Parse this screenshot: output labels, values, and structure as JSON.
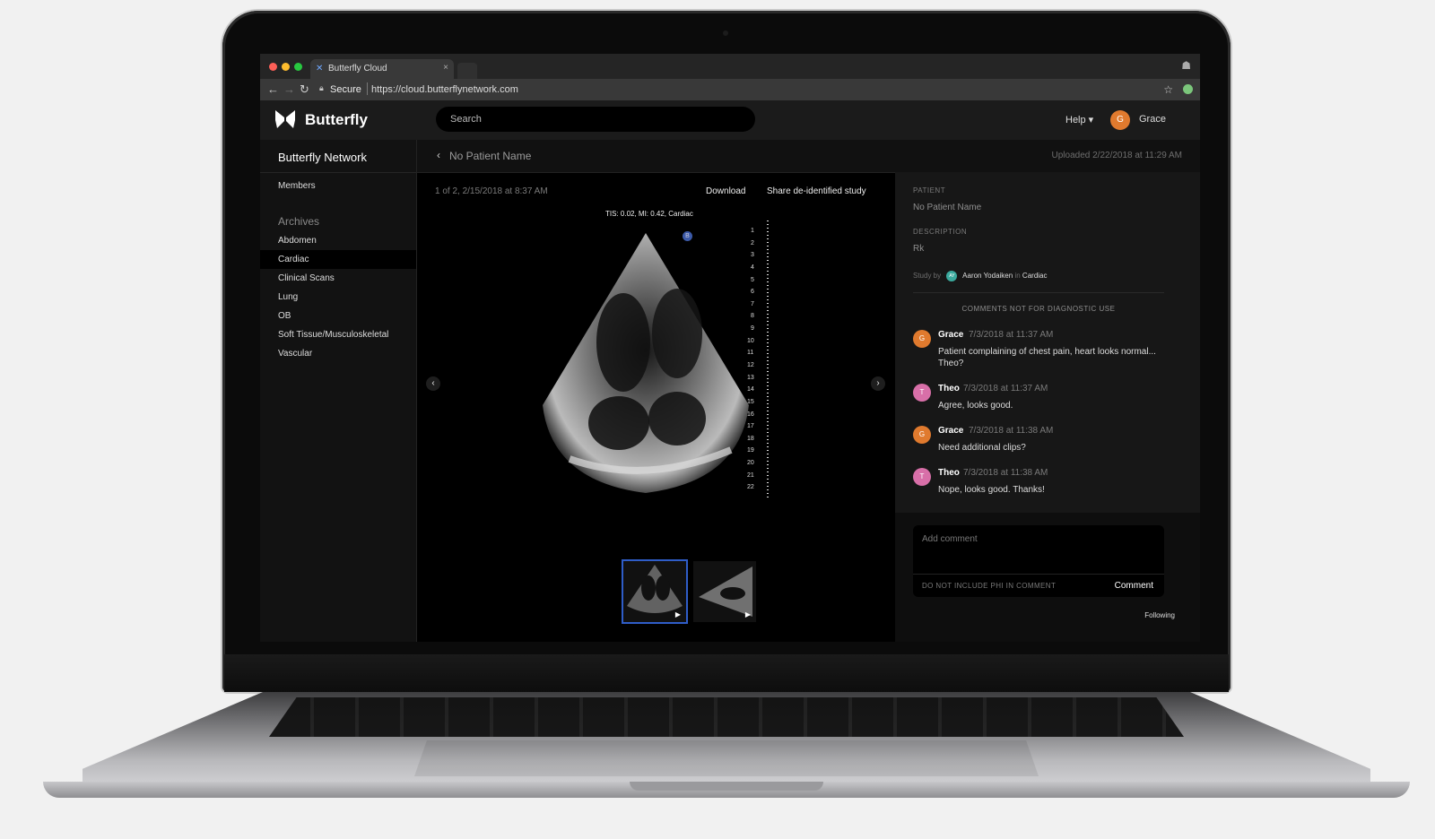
{
  "browser": {
    "tab_title": "Butterfly Cloud",
    "tab_close": "×",
    "secure_label": "Secure",
    "url": "https://cloud.butterflynetwork.com"
  },
  "header": {
    "logo_text": "Butterfly",
    "search_placeholder": "Search",
    "help_label": "Help ▾",
    "user_initial": "G",
    "user_name": "Grace"
  },
  "sidebar": {
    "org_name": "Butterfly Network",
    "members_label": "Members",
    "archives_heading": "Archives",
    "items": [
      {
        "label": "Abdomen"
      },
      {
        "label": "Cardiac"
      },
      {
        "label": "Clinical Scans"
      },
      {
        "label": "Lung"
      },
      {
        "label": "OB"
      },
      {
        "label": "Soft Tissue/Musculoskeletal"
      },
      {
        "label": "Vascular"
      }
    ]
  },
  "study": {
    "title": "No Patient Name",
    "uploaded": "Uploaded 2/22/2018 at 11:29 AM",
    "clip_info": "1 of 2, 2/15/2018 at 8:37 AM",
    "download_label": "Download",
    "share_label": "Share de-identified study",
    "overlay": "TIS: 0.02, MI: 0.42, Cardiac",
    "marker": "B",
    "depth_ticks": [
      "1",
      "2",
      "3",
      "4",
      "5",
      "6",
      "7",
      "8",
      "9",
      "10",
      "11",
      "12",
      "13",
      "14",
      "15",
      "16",
      "17",
      "18",
      "19",
      "20",
      "21",
      "22"
    ]
  },
  "panel": {
    "patient_label": "PATIENT",
    "patient_value": "No Patient Name",
    "description_label": "DESCRIPTION",
    "description_value": "Rk",
    "study_by_prefix": "Study by",
    "study_by_initials": "AY",
    "study_by_name": "Aaron Yodaiken",
    "study_by_in": "in",
    "study_by_archive": "Cardiac",
    "comments_heading": "COMMENTS NOT FOR DIAGNOSTIC USE",
    "comments": [
      {
        "initial": "G",
        "name": "Grace",
        "time": "7/3/2018 at 11:37 AM",
        "text": "Patient complaining of chest pain, heart looks normal... Theo?",
        "color": "#e07a2e"
      },
      {
        "initial": "T",
        "name": "Theo",
        "time": "7/3/2018 at 11:37 AM",
        "text": "Agree, looks good.",
        "color": "#d86fa8"
      },
      {
        "initial": "G",
        "name": "Grace",
        "time": "7/3/2018 at 11:38 AM",
        "text": "Need additional clips?",
        "color": "#e07a2e"
      },
      {
        "initial": "T",
        "name": "Theo",
        "time": "7/3/2018 at 11:38 AM",
        "text": "Nope, looks good. Thanks!",
        "color": "#d86fa8"
      }
    ],
    "add_comment_placeholder": "Add comment",
    "phi_warning": "DO NOT INCLUDE PHI IN COMMENT",
    "comment_button": "Comment",
    "following_label": "Following"
  },
  "colors": {
    "accent_selected": "#2f5dc8",
    "grace_avatar": "#e07a2e",
    "theo_avatar": "#d86fa8"
  }
}
